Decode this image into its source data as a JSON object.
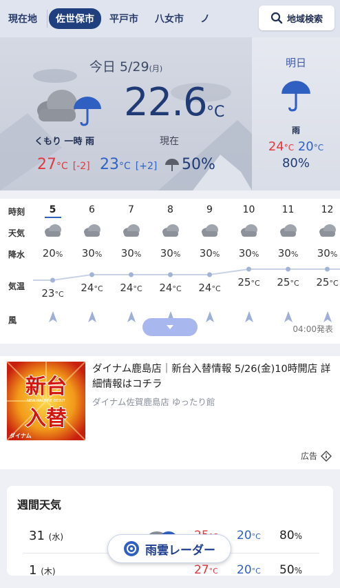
{
  "tabs": [
    {
      "label": "現在地",
      "active": false
    },
    {
      "label": "佐世保市",
      "active": true
    },
    {
      "label": "平戸市",
      "active": false
    },
    {
      "label": "八女市",
      "active": false
    },
    {
      "label": "ノ",
      "active": false
    }
  ],
  "search_button": {
    "label": "地域検索",
    "icon": "search-icon"
  },
  "today": {
    "label": "今日",
    "date": "5/29",
    "dow": "(月)",
    "condition": "くもり 一時 雨",
    "current_temp": "22.6",
    "current_unit": "°C",
    "current_label": "現在",
    "high": "27",
    "high_unit": "°C",
    "high_diff": "[-2]",
    "low": "23",
    "low_unit": "°C",
    "low_diff": "[+2]",
    "precip": "50%",
    "icons": [
      "cloud-icon",
      "umbrella-icon"
    ]
  },
  "tomorrow": {
    "label": "明日",
    "condition": "雨",
    "high": "24",
    "low": "20",
    "unit": "°C",
    "precip": "80%",
    "icon": "umbrella-icon"
  },
  "hourly": {
    "row_labels": [
      "時刻",
      "天気",
      "降水",
      "気温",
      "風"
    ],
    "hours": [
      {
        "hour": "5",
        "pop": "20",
        "temp": "23"
      },
      {
        "hour": "6",
        "pop": "30",
        "temp": "24"
      },
      {
        "hour": "7",
        "pop": "30",
        "temp": "24"
      },
      {
        "hour": "8",
        "pop": "30",
        "temp": "24"
      },
      {
        "hour": "9",
        "pop": "30",
        "temp": "24"
      },
      {
        "hour": "10",
        "pop": "30",
        "temp": "25"
      },
      {
        "hour": "11",
        "pop": "30",
        "temp": "25"
      },
      {
        "hour": "12",
        "pop": "30",
        "temp": "25"
      }
    ],
    "pop_unit": "%",
    "temp_unit": "°C",
    "weather_icon": "cloud-icon",
    "wind_icon": "wind-arrow-icon",
    "issued": "04:00発表",
    "expand_icon": "chevron-down-icon"
  },
  "ad": {
    "title": "ダイナム鹿島店｜新台入替情報 5/26(金)10時開店 詳細情報はコチラ",
    "sub": "ダイナム佐賀鹿島店 ゆったり館",
    "label": "広告",
    "image_text": [
      "新台",
      "入替"
    ],
    "image_small": "NEW MACHINE DEBUT",
    "image_logo": "ダイナム",
    "ad_icon": "info-icon"
  },
  "weekly": {
    "title": "週間天気",
    "rows": [
      {
        "day": "31",
        "dow": "(水)",
        "high": "25",
        "low": "20",
        "pop": "80",
        "unit": "°C",
        "pop_unit": "%"
      },
      {
        "day": "1",
        "dow": "(木)",
        "high": "27",
        "low": "20",
        "pop": "50",
        "unit": "°C",
        "pop_unit": "%"
      }
    ]
  },
  "radar_button": {
    "label": "雨雲レーダー",
    "icon": "radar-icon"
  }
}
